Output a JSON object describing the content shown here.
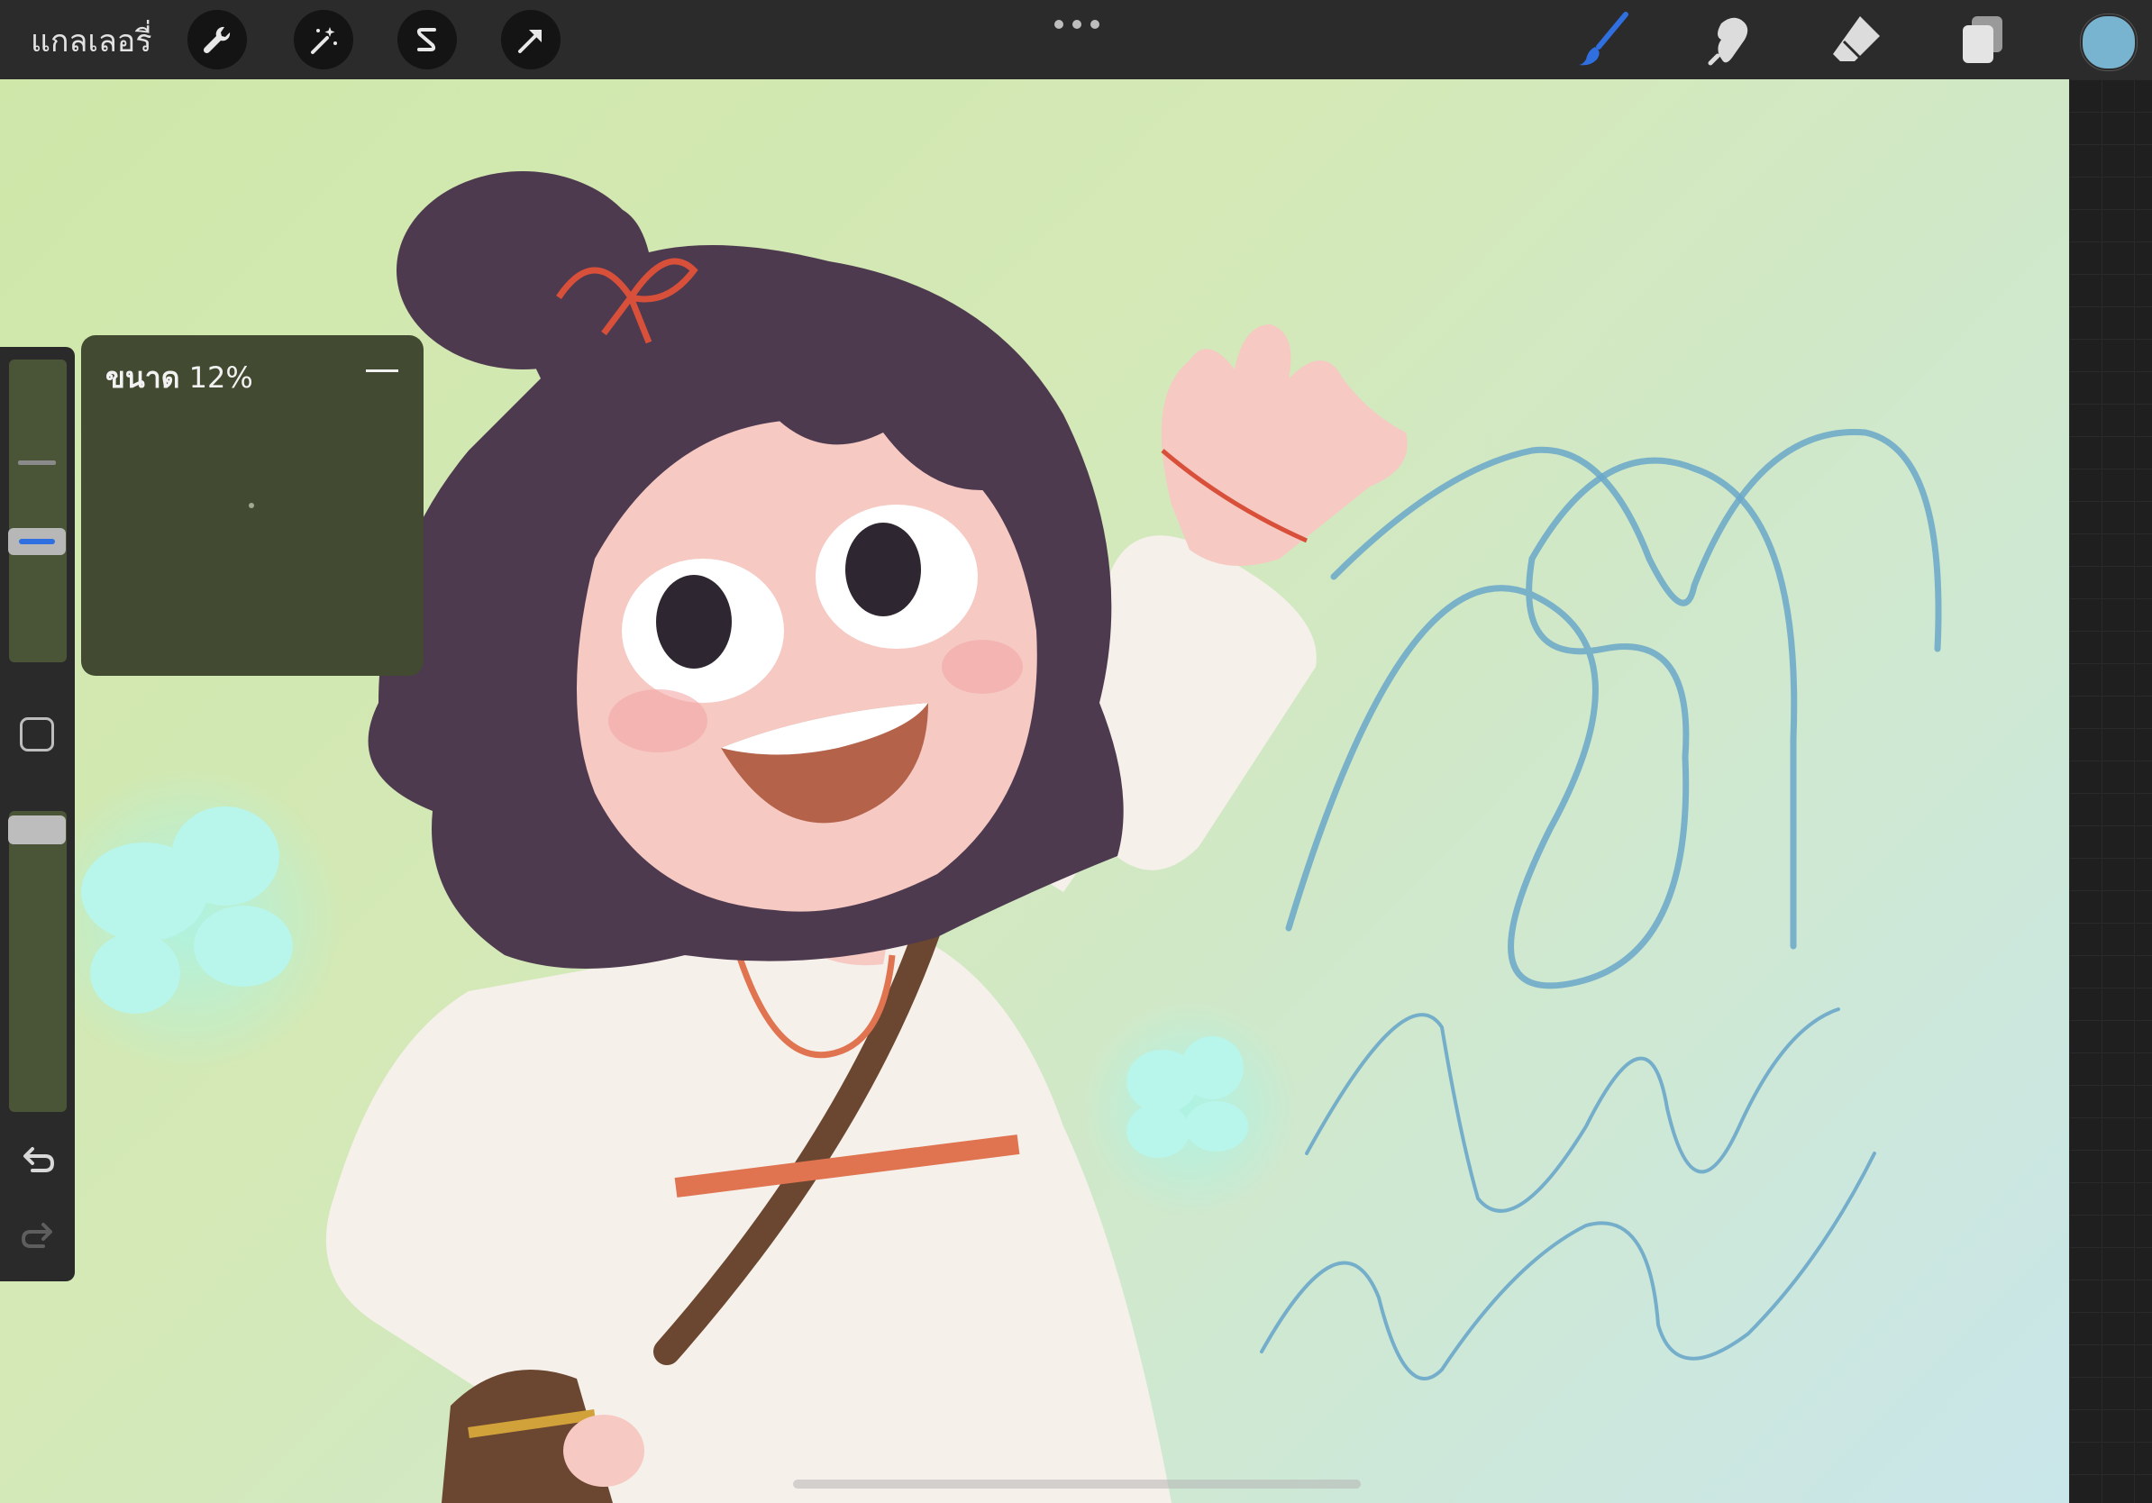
{
  "app": {
    "gallery_label": "แกลเลอรี่"
  },
  "toolbar": {
    "left_tools": [
      {
        "name": "actions",
        "icon": "wrench-icon"
      },
      {
        "name": "adjustments",
        "icon": "magic-wand-icon"
      },
      {
        "name": "selection",
        "icon": "selection-s-icon"
      },
      {
        "name": "transform",
        "icon": "arrow-cursor-icon"
      }
    ],
    "more_icon": "ellipsis-icon",
    "right_tools": [
      {
        "name": "brush",
        "icon": "brush-icon",
        "active": true
      },
      {
        "name": "smudge",
        "icon": "smudge-icon",
        "active": false
      },
      {
        "name": "eraser",
        "icon": "eraser-icon",
        "active": false
      },
      {
        "name": "layers",
        "icon": "layers-icon",
        "active": false
      }
    ],
    "active_color": "#78b3cf",
    "active_tool_color": "#2f6fe0"
  },
  "sidebar": {
    "size_slider_icon": "size-slider",
    "modify_button_icon": "square-icon",
    "opacity_slider_icon": "opacity-slider",
    "undo_icon": "undo-icon",
    "redo_icon": "redo-icon"
  },
  "size_popup": {
    "label": "ขนาด",
    "value": "12%",
    "collapse_icon": "dash-icon"
  },
  "canvas": {
    "description_colors": {
      "hair": "#4e3a4f",
      "skin": "#f6c9c3",
      "shirt": "#f6f1ea",
      "squiggle": "#6aa7c9",
      "accent": "#e07451"
    }
  }
}
